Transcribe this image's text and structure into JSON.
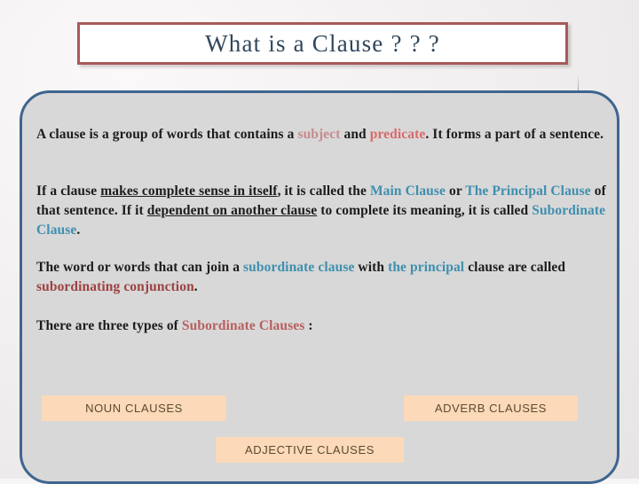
{
  "slide": {
    "title": "What is a Clause ? ? ?",
    "colors": {
      "title_text": "#31475c",
      "title_border": "#a85a5a",
      "panel_border": "#3f6490",
      "panel_fill": "#d8d8d8",
      "highlight_rose": "#c58b8b",
      "highlight_pink": "#d96a6a",
      "highlight_teal": "#3f8fae",
      "highlight_brick": "#9e4141",
      "box_fill": "#fbd9b9",
      "box_text": "#5c4a2e"
    }
  },
  "paragraphs": {
    "p1": {
      "seg1": "A clause is a group of words that contains a ",
      "subject": "subject",
      "seg2": " and ",
      "predicate": "predicate",
      "seg3": ". It forms a part of a sentence."
    },
    "p2": {
      "seg1": "If a clause ",
      "underline1": "makes complete sense in itself",
      "seg2": ", it is called the ",
      "main_clause": "Main Clause",
      "seg3": " or ",
      "principal_clause": "The Principal Clause",
      "seg4": " of that sentence. If it ",
      "underline2": "dependent on another clause",
      "seg5": " to complete its meaning, it is called ",
      "subordinate_clause": "Subordinate Clause",
      "seg6": "."
    },
    "p3": {
      "seg1": "The word or words that can join a ",
      "subordinate_clause": "subordinate clause",
      "seg2": " with ",
      "the_principal": "the principal",
      "seg3": " clause are called ",
      "subordinating_conjunction": "subordinating conjunction",
      "seg4": "."
    },
    "p4": {
      "seg1": "There are three types of ",
      "subordinate_clauses": "Subordinate Clauses",
      "seg2": " :"
    }
  },
  "clause_boxes": [
    {
      "label": "NOUN CLAUSES"
    },
    {
      "label": "ADVERB CLAUSES"
    },
    {
      "label": "ADJECTIVE CLAUSES"
    }
  ]
}
